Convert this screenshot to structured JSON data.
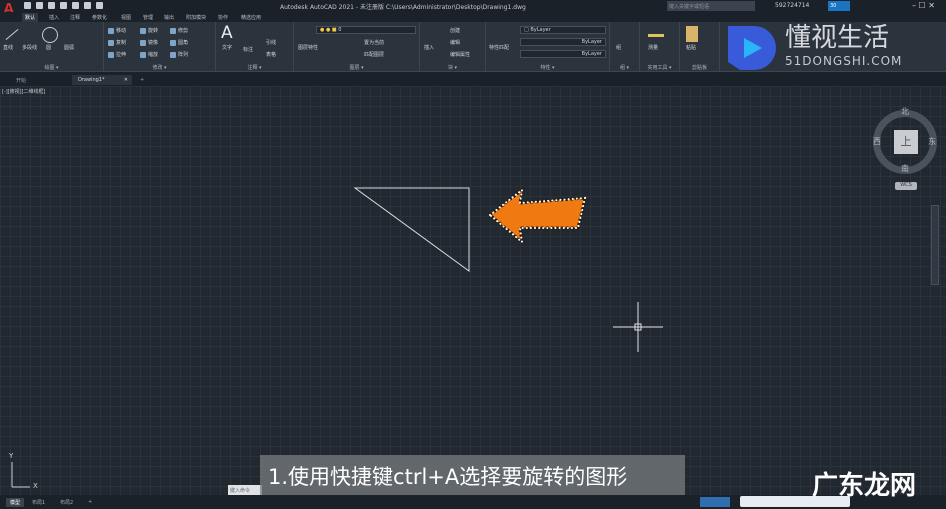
{
  "titlebar": {
    "title": "Autodesk AutoCAD 2021 - 未注册版    C:\\Users\\Administrator\\Desktop\\Drawing1.dwg",
    "search_placeholder": "键入关键字或短语",
    "user": "592724714",
    "badge": "30"
  },
  "ribbon_tabs": [
    "默认",
    "插入",
    "注释",
    "参数化",
    "视图",
    "管理",
    "输出",
    "附加模块",
    "协作",
    "精选应用"
  ],
  "panels": {
    "draw": {
      "label": "绘图 ▾",
      "tools": [
        "直线",
        "多段线",
        "圆",
        "圆弧"
      ]
    },
    "modify": {
      "label": "修改 ▾",
      "tools": [
        "移动",
        "旋转",
        "修剪",
        "复制",
        "镜像",
        "圆角",
        "拉伸",
        "缩放",
        "阵列"
      ]
    },
    "annotation": {
      "label": "注释 ▾",
      "tools": [
        "文字",
        "标注",
        "引线",
        "表格"
      ]
    },
    "layers": {
      "label": "图层 ▾",
      "tools": [
        "图层特性",
        "置为当前",
        "匹配图层"
      ],
      "current_layer": "0"
    },
    "block": {
      "label": "块 ▾",
      "tools": [
        "插入",
        "创建",
        "编辑",
        "编辑属性"
      ]
    },
    "properties": {
      "label": "特性 ▾",
      "tools": [
        "特性匹配"
      ],
      "color": "ByLayer",
      "linetype": "ByLayer",
      "lineweight": "ByLayer"
    },
    "groups": {
      "label": "组 ▾",
      "tools": [
        "组"
      ]
    },
    "utilities": {
      "label": "实用工具 ▾",
      "tools": [
        "测量"
      ]
    },
    "clipboard": {
      "label": "剪贴板",
      "tools": [
        "粘贴"
      ]
    }
  },
  "doc_tabs": [
    "开始",
    "Drawing1*"
  ],
  "viewport_label": "[-][俯视][二维线框]",
  "viewcube": {
    "face": "上",
    "north": "北",
    "south": "南",
    "east": "东",
    "west": "西",
    "wcs": "WCS"
  },
  "ucs": {
    "x": "X",
    "y": "Y"
  },
  "command_placeholder": "键入命令",
  "layout_tabs": [
    "模型",
    "布局1",
    "布局2"
  ],
  "subtitle": "1.使用快捷键ctrl+A选择要旋转的图形",
  "watermarks": {
    "brand_cn": "懂视生活",
    "brand_en": "51DONGSHI.COM",
    "corner": "广东龙网"
  },
  "colors": {
    "arrow": "#f07a12",
    "autocad_red": "#d9322b",
    "brand_blue": "#3a5bd9"
  }
}
